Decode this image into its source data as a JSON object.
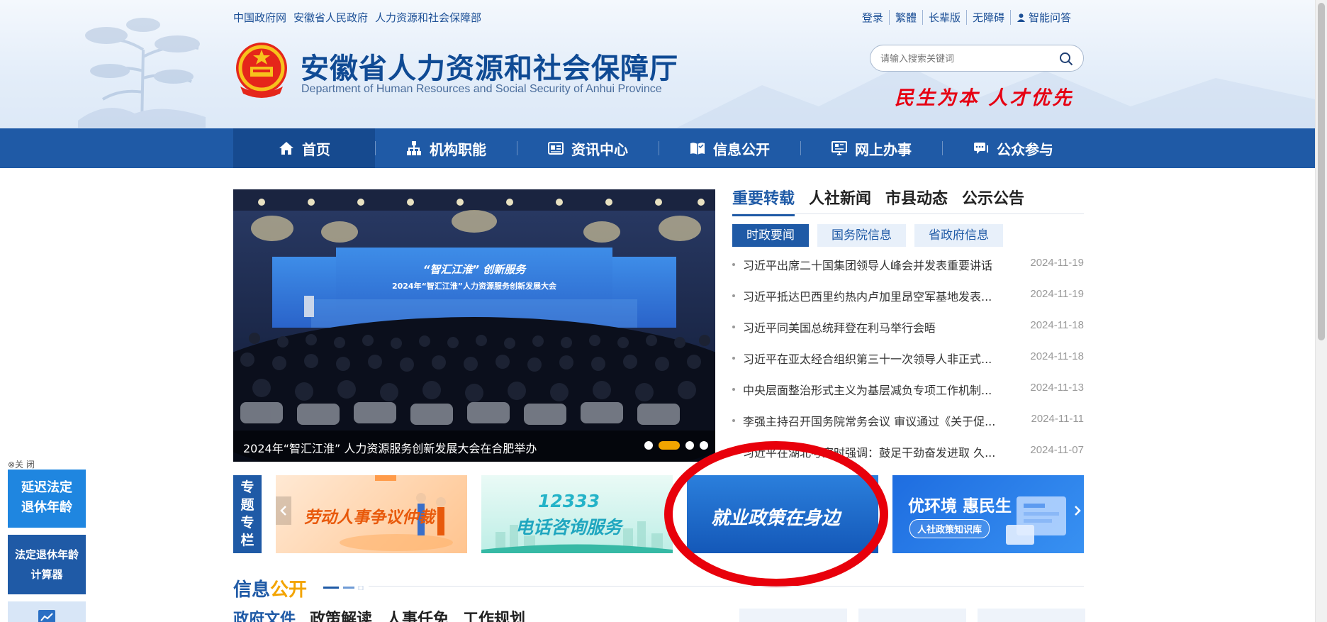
{
  "header": {
    "top_links": [
      "中国政府网",
      "安徽省人民政府",
      "人力资源和社会保障部"
    ],
    "right_links": [
      "登录",
      "繁體",
      "长辈版",
      "无障碍",
      "智能问答"
    ],
    "site_title": "安徽省人力资源和社会保障厅",
    "site_subtitle": "Department of Human Resources and Social Security of Anhui Province",
    "search_placeholder": "请输入搜索关键词",
    "slogan": "民生为本  人才优先"
  },
  "nav": {
    "items": [
      {
        "label": "首页",
        "icon": "home-icon"
      },
      {
        "label": "机构职能",
        "icon": "org-chart-icon"
      },
      {
        "label": "资讯中心",
        "icon": "news-icon"
      },
      {
        "label": "信息公开",
        "icon": "book-icon"
      },
      {
        "label": "网上办事",
        "icon": "monitor-icon"
      },
      {
        "label": "公众参与",
        "icon": "chat-icon"
      }
    ],
    "active_index": 0
  },
  "carousel": {
    "caption": "2024年“智汇江淮” 人力资源服务创新发展大会在合肥举办",
    "stage_screen_line1": "“智汇江淮” 创新服务",
    "stage_screen_line2": "2024年“智汇江淮”人力资源服务创新发展大会",
    "slide_count": 4,
    "active_slide": 1
  },
  "news": {
    "tabs": [
      "重要转载",
      "人社新闻",
      "市县动态",
      "公示公告"
    ],
    "active_tab": 0,
    "sub_tabs": [
      "时政要闻",
      "国务院信息",
      "省政府信息"
    ],
    "active_sub_tab": 0,
    "items": [
      {
        "title": "习近平出席二十国集团领导人峰会并发表重要讲话",
        "date": "2024-11-19"
      },
      {
        "title": "习近平抵达巴西里约热内卢加里昂空军基地发表...",
        "date": "2024-11-19"
      },
      {
        "title": "习近平同美国总统拜登在利马举行会晤",
        "date": "2024-11-18"
      },
      {
        "title": "习近平在亚太经合组织第三十一次领导人非正式...",
        "date": "2024-11-18"
      },
      {
        "title": "中央层面整治形式主义为基层减负专项工作机制...",
        "date": "2024-11-13"
      },
      {
        "title": "李强主持召开国务院常务会议 审议通过《关于促...",
        "date": "2024-11-11"
      },
      {
        "title": "习近平在湖北考察时强调：鼓足干劲奋发进取 久...",
        "date": "2024-11-07"
      }
    ]
  },
  "special": {
    "label_chars": [
      "专",
      "题",
      "专",
      "栏"
    ],
    "banner1": "劳动人事争议仲裁",
    "banner2_line1": "12333",
    "banner2_line2": "电话咨询服务",
    "banner3": "就业政策在身边",
    "banner4_line1": "优环境 惠民生",
    "banner4_line2": "人社政策知识库"
  },
  "info": {
    "title_main": "信息",
    "title_highlight": "公开",
    "tabs": [
      "政府文件",
      "政策解读",
      "人事任免",
      "工作规划"
    ]
  },
  "floating": {
    "close_label": "⊗关 闭",
    "box1_line1": "延迟法定",
    "box1_line2": "退休年龄",
    "box2_line1": "法定退休年龄",
    "box2_line2": "计算器"
  },
  "colors": {
    "primary_blue": "#1f5aa6",
    "accent_orange": "#f3a400",
    "slogan_red": "#e60012",
    "annotation_red": "#e8000b"
  }
}
